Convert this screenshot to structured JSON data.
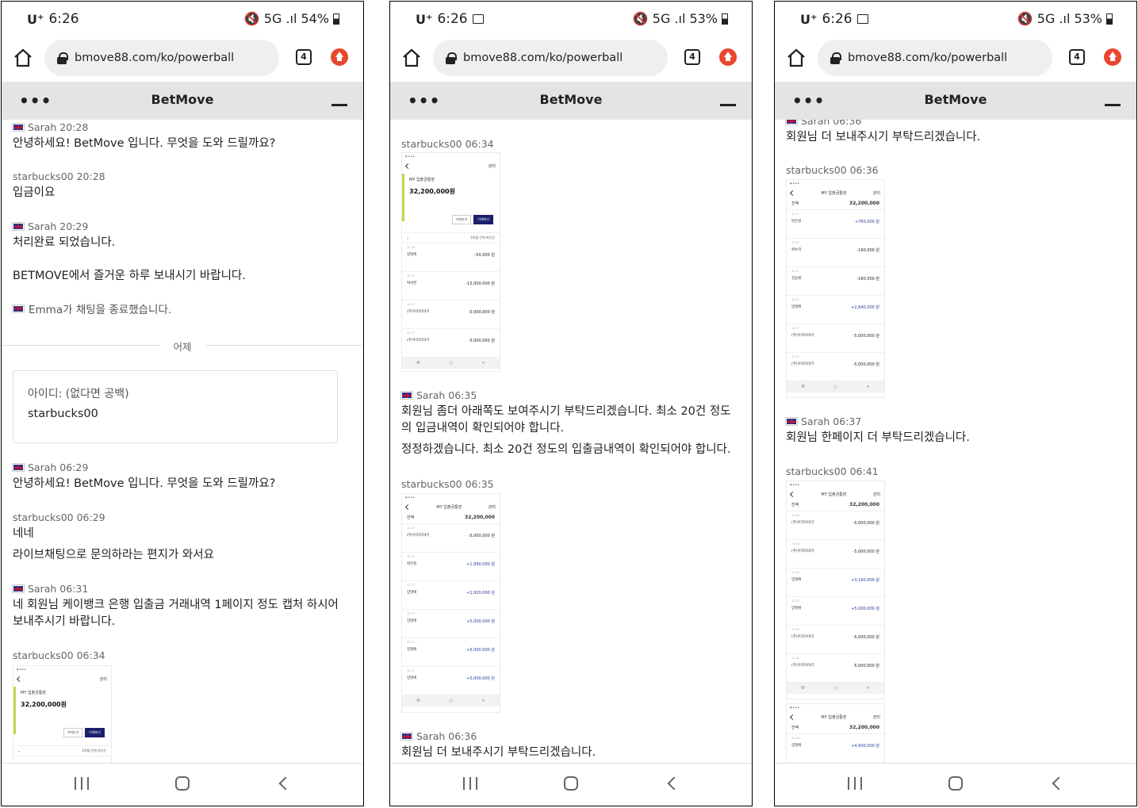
{
  "phones": [
    {
      "status": {
        "carrier": "U⁺",
        "time": "6:26",
        "signal": "5G .ıl",
        "battery": "54%"
      },
      "url": "bmove88.com/ko/powerball",
      "tab_count": "4",
      "app_title": "BetMove",
      "messages": [
        {
          "meta": "Sarah 20:28",
          "flag": true,
          "lines": [
            "안녕하세요! BetMove 입니다. 무엇을 도와 드릴까요?"
          ]
        },
        {
          "meta": "starbucks00 20:28",
          "flag": false,
          "lines": [
            "입금이요"
          ]
        },
        {
          "meta": "Sarah 20:29",
          "flag": true,
          "lines": [
            "처리완료 되었습니다.",
            "BETMOVE에서 즐거운 하루 보내시기 바랍니다."
          ]
        },
        {
          "notice": "Emma가 채팅을 종료했습니다."
        },
        {
          "divider": "어제"
        },
        {
          "form_q": "아이디: (없다면 공백)",
          "form_a": "starbucks00"
        },
        {
          "meta": "Sarah 06:29",
          "flag": true,
          "lines": [
            "안녕하세요! BetMove 입니다. 무엇을 도와 드릴까요?"
          ]
        },
        {
          "meta": "starbucks00 06:29",
          "flag": false,
          "lines": [
            "네네",
            "라이브채팅으로 문의하라는 편지가 와서요"
          ]
        },
        {
          "meta": "Sarah 06:31",
          "flag": true,
          "lines": [
            "네 회원님 케이뱅크 은행 입출금 거래내역 1페이지 정도 캡처 하시어 보내주시기 바랍니다."
          ]
        },
        {
          "meta": "starbucks00 06:34",
          "flag": false
        }
      ]
    },
    {
      "status": {
        "carrier": "U⁺",
        "time": "6:26",
        "signal": "5G .ıl",
        "battery": "53%"
      },
      "url": "bmove88.com/ko/powerball",
      "tab_count": "4",
      "app_title": "BetMove",
      "messages": [
        {
          "meta": "starbucks00 06:34",
          "flag": false
        },
        {
          "meta": "Sarah 06:35",
          "flag": true,
          "lines": [
            "회원님 좀더 아래쪽도 보여주시기 부탁드리겠습니다. 최소 20건 정도의 입금내역이 확인되어야 합니다.",
            "정정하겠습니다. 최소 20건 정도의 입출금내역이 확인되어야 합니다."
          ]
        },
        {
          "meta": "starbucks00 06:35",
          "flag": false
        },
        {
          "meta": "Sarah 06:36",
          "flag": true,
          "lines": [
            "회원님 더 보내주시기 부탁드리겠습니다."
          ]
        }
      ]
    },
    {
      "status": {
        "carrier": "U⁺",
        "time": "6:26",
        "signal": "5G .ıl",
        "battery": "53%"
      },
      "url": "bmove88.com/ko/powerball",
      "tab_count": "4",
      "app_title": "BetMove",
      "messages": [
        {
          "meta": "Sarah 06:36",
          "flag": true,
          "lines": [
            "회원님 더 보내주시기 부탁드리겠습니다."
          ]
        },
        {
          "meta": "starbucks00 06:36",
          "flag": false
        },
        {
          "meta": "Sarah 06:37",
          "flag": true,
          "lines": [
            "회원님 한페이지 더 부탁드리겠습니다."
          ]
        },
        {
          "meta": "starbucks00 06:41",
          "flag": false
        }
      ]
    }
  ],
  "screenshots": {
    "account_name": "MY 입출금통장",
    "account_balance": "32,200,000",
    "won": "원",
    "btn_transfer_in": "가져오기",
    "btn_transfer_out": "이체하기",
    "filter": "3개월·전체·최신순",
    "header_title": "MY 입출금통장",
    "header_action": "관리",
    "balance_label": "잔액",
    "shot_a_rows": [
      {
        "date": "12.28",
        "name": "양명애",
        "amount": "-50,000 원"
      },
      {
        "date": "12.27",
        "name": "박서연",
        "amount": "-15,000,000 원"
      },
      {
        "date": "12.27",
        "name": "(주)우리이야기",
        "amount": "-5,000,000 원"
      },
      {
        "date": "12.27",
        "name": "(주)우리이야기",
        "amount": "-5,000,000 원"
      }
    ],
    "shot_b_rows": [
      {
        "date": "12.27",
        "name": "(주)우리이야기",
        "amount": "-5,000,000 원"
      },
      {
        "date": "12.27",
        "name": "박은원",
        "amount": "+1,990,000 원"
      },
      {
        "date": "12.27",
        "name": "양명애",
        "amount": "+1,920,000 원"
      },
      {
        "date": "12.27",
        "name": "양명애",
        "amount": "+5,000,000 원"
      },
      {
        "date": "12.27",
        "name": "양명애",
        "amount": "+5,000,000 원"
      },
      {
        "date": "12.27",
        "name": "양명애",
        "amount": "+5,000,000 원"
      }
    ],
    "shot_c_rows": [
      {
        "date": "12.27",
        "name": "박은원",
        "amount": "+760,000 원"
      },
      {
        "date": "12.27",
        "name": "위누리",
        "amount": "-160,000 원"
      },
      {
        "date": "12.27",
        "name": "김동환",
        "amount": "-160,000 원"
      },
      {
        "date": "12.27",
        "name": "양명애",
        "amount": "+2,640,000 원"
      },
      {
        "date": "12.27",
        "name": "(주)우리이야기",
        "amount": "-5,000,000 원"
      },
      {
        "date": "12.27",
        "name": "(주)우리이야기",
        "amount": "-5,000,000 원"
      }
    ],
    "shot_d_rows": [
      {
        "date": "12.26",
        "name": "(주)우리이야기",
        "amount": "-5,000,000 원"
      },
      {
        "date": "12.26",
        "name": "(주)우리이야기",
        "amount": "-5,000,000 원"
      },
      {
        "date": "12.25",
        "name": "양명애",
        "amount": "+3,160,000 원"
      },
      {
        "date": "12.25",
        "name": "양명애",
        "amount": "+5,000,000 원"
      },
      {
        "date": "12.25",
        "name": "(주)우리이야기",
        "amount": "-5,000,000 원"
      },
      {
        "date": "12.25",
        "name": "(주)우리이야기",
        "amount": "-5,000,000 원"
      }
    ],
    "shot_e_rows": [
      {
        "date": "12.26",
        "name": "양명애",
        "amount": "+4,900,000 원"
      }
    ]
  },
  "colors": {
    "accent_bar": "#c4d648",
    "button_dark": "#1b1f6b",
    "ext_icon": "#e8472f",
    "appbar": "#e4e4e4"
  }
}
